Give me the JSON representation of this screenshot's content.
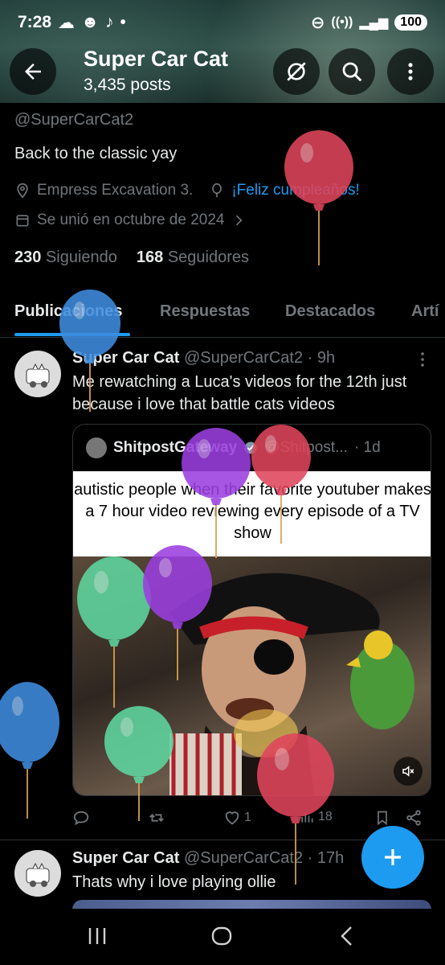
{
  "status": {
    "time": "7:28",
    "battery": "100"
  },
  "header": {
    "title": "Super Car Cat",
    "posts": "3,435 posts"
  },
  "profile": {
    "handle": "@SuperCarCat2",
    "bio": "Back to the classic yay",
    "location": "Empress Excavation 3.",
    "birthday": "¡Feliz cumpleaños!",
    "joined": "Se unió en octubre de 2024",
    "following_count": "230",
    "following_label": "Siguiendo",
    "followers_count": "168",
    "followers_label": "Seguidores"
  },
  "tabs": [
    "Publicaciones",
    "Respuestas",
    "Destacados",
    "Artí"
  ],
  "tweets": [
    {
      "name": "Super Car Cat",
      "handle": "@SuperCarCat2 · 9h",
      "text": "Me rewatching a Luca's videos for the 12th just because i love that battle cats videos",
      "quote": {
        "name": "ShitpostGateway",
        "handle": "@Shitpost...",
        "time": "· 1d",
        "caption": "autistic people when their favorite youtuber makes a 7 hour video reviewing every episode of a TV show"
      },
      "likes": "1",
      "views": "18"
    },
    {
      "name": "Super Car Cat",
      "handle": "@SuperCarCat2 · 17h",
      "text": "Thats why i love playing ollie"
    }
  ],
  "colors": {
    "accent": "#1d9bf0",
    "balloon_red": "#e0455c",
    "balloon_purple": "#9b3fe0",
    "balloon_green": "#5fd6a0",
    "balloon_blue": "#3f8de0"
  },
  "icons": [
    "back-arrow-icon",
    "hide-icon",
    "search-icon",
    "more-icon",
    "location-icon",
    "balloon-icon",
    "calendar-icon",
    "chevron-right-icon",
    "reply-icon",
    "retweet-icon",
    "like-icon",
    "views-icon",
    "bookmark-icon",
    "share-icon",
    "mute-icon",
    "plus-icon",
    "nav-recents-icon",
    "nav-home-icon",
    "nav-back-icon"
  ]
}
